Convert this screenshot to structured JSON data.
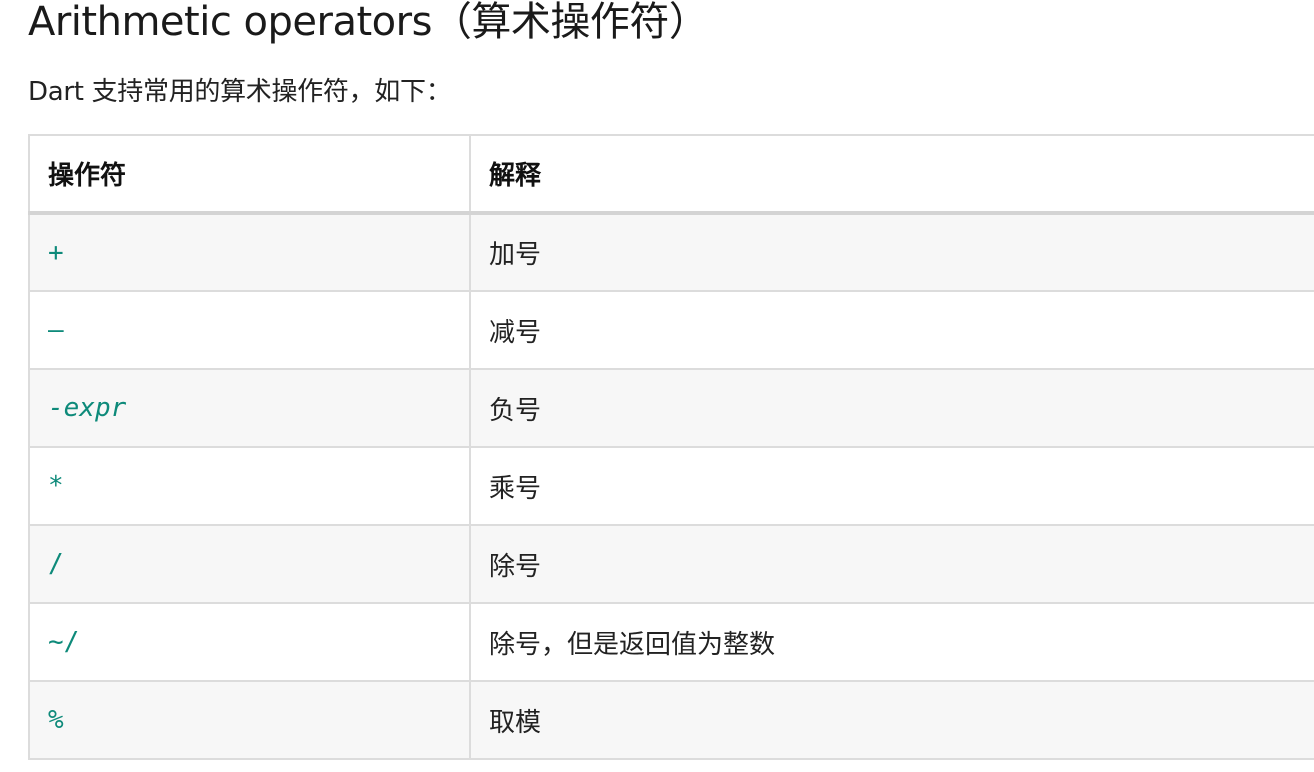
{
  "heading": "Arithmetic operators（算术操作符）",
  "intro": "Dart 支持常用的算术操作符，如下：",
  "table": {
    "headers": [
      "操作符",
      "解释"
    ],
    "rows": [
      {
        "operator": "+",
        "description": "加号"
      },
      {
        "operator": "–",
        "description": "减号"
      },
      {
        "operator": "-expr",
        "description": "负号"
      },
      {
        "operator": "*",
        "description": "乘号"
      },
      {
        "operator": "/",
        "description": "除号"
      },
      {
        "operator": "~/",
        "description": "除号，但是返回值为整数"
      },
      {
        "operator": "%",
        "description": "取模"
      }
    ]
  },
  "colors": {
    "operator_text": "#0e8a7a",
    "row_alt_bg": "#f7f7f7",
    "border": "#dcdcdc"
  }
}
